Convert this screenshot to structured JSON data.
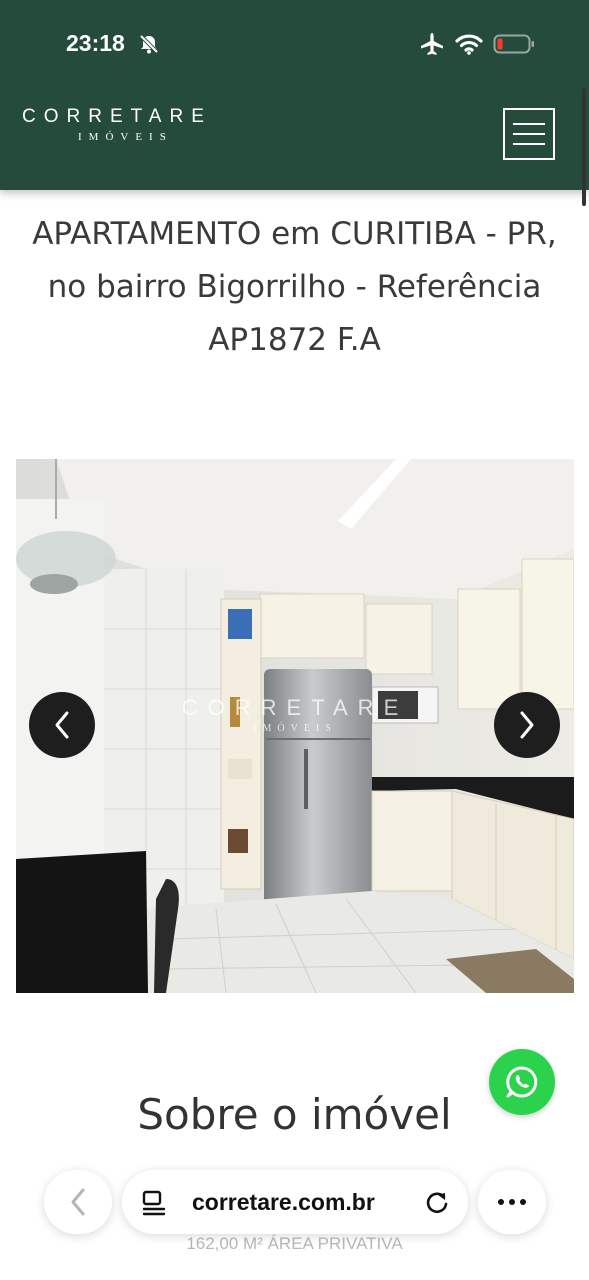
{
  "status_bar": {
    "time": "23:18",
    "icons": [
      "bell-slash-icon",
      "airplane-icon",
      "wifi-icon",
      "battery-low-icon"
    ]
  },
  "header": {
    "brand_name": "CORRETARE",
    "brand_sub": "IMÓVEIS",
    "menu_icon": "hamburger-menu-icon",
    "background": "#244b3c"
  },
  "listing": {
    "title": "APARTAMENTO em CURITIBA - PR, no bairro Bigorrilho - Referência AP1872 F.A"
  },
  "gallery": {
    "watermark_name": "CORRETARE",
    "watermark_sub": "IMÓVEIS",
    "prev_icon": "chevron-left-icon",
    "next_icon": "chevron-right-icon"
  },
  "section": {
    "heading": "Sobre o imóvel",
    "area_text": "162,00 M² ÁREA PRIVATIVA"
  },
  "whatsapp": {
    "icon": "whatsapp-icon",
    "color": "#2bd24b"
  },
  "browser_bar": {
    "url": "corretare.com.br",
    "back_icon": "chevron-left-icon",
    "page_icon": "page-menu-icon",
    "reload_icon": "reload-icon",
    "more_icon": "more-dots-icon"
  }
}
